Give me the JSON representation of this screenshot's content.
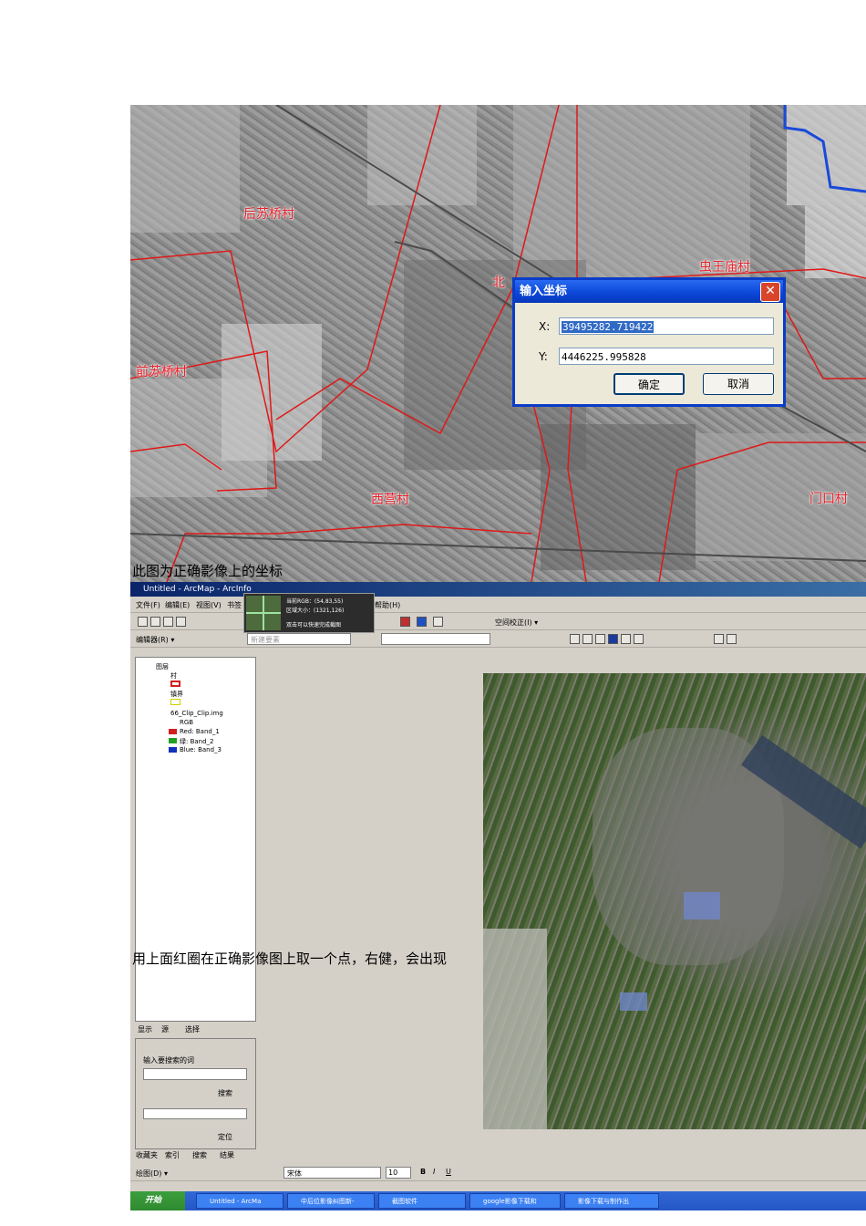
{
  "map": {
    "village_labels": [
      "前苏桥村",
      "后苏桥村",
      "北",
      "虫王庙村",
      "西营村",
      "门口村"
    ]
  },
  "dialog": {
    "title": "输入坐标",
    "close_label": "✕",
    "x_label": "X:",
    "x_value": "39495282.719422",
    "y_label": "Y:",
    "y_value": "4446225.995828",
    "ok_label": "确定",
    "cancel_label": "取消"
  },
  "captions": {
    "first": "此图为正确影像上的坐标",
    "second": "用上面红圈在正确影像图上取一个点，右健，会出现"
  },
  "arcmap": {
    "window_title": "Untitled - ArcMap - ArcInfo",
    "menu": [
      "文件(F)",
      "编辑(E)",
      "视图(V)",
      "书签",
      "帮助(H)"
    ],
    "georef_label": "空间校正(I) ▾",
    "editor_label": "编辑器(R) ▾",
    "task_label": "新建要素",
    "popup": {
      "line1": "当前RGB：(54,83,55)",
      "line2": "区域大小：(1321,126)",
      "line3": "双击可以快速完成截图"
    },
    "toc": {
      "root": "图层",
      "layer1": "村",
      "layer2": "镇界",
      "layer3": "66_Clip_Clip.img",
      "rgb": "RGB",
      "red": "Red:    Band_1",
      "green": "绿:  Band_2",
      "blue": "Blue:   Band_3"
    },
    "toc_tabs": [
      "显示",
      "源",
      "选择"
    ],
    "search": {
      "prompt": "输入要搜索的词",
      "search_button": "搜索",
      "locate_button": "定位",
      "tabs": [
        "收藏夹",
        "索引",
        "搜索",
        "结果"
      ]
    },
    "draw_toolbar": {
      "draw_label": "绘图(D) ▾",
      "font": "宋体",
      "size": "10",
      "bold": "B",
      "italic": "I",
      "underline": "U"
    },
    "taskbar": {
      "start": "开始",
      "items": [
        "Untitled - ArcMa",
        "中后位影像纠图新-",
        "截图软件",
        "google影像下载和",
        "影像下载与制作出"
      ]
    }
  }
}
